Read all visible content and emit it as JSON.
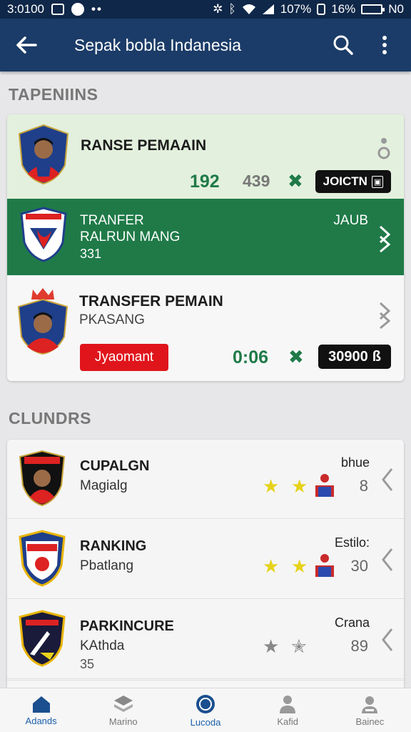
{
  "status_bar": {
    "time": "3:0100",
    "signal_text": "107%",
    "battery": "16%",
    "network": "N0"
  },
  "app_bar": {
    "title": "Sepak bobla Indanesia"
  },
  "sections": {
    "transfers_title": "TAPENIINS",
    "clubs_title": "CLUNDRS"
  },
  "transfers": [
    {
      "title": "RANSE PEMAAIN",
      "value_green": "192",
      "value_gray": "439",
      "pill": "JOICTN"
    },
    {
      "title": "TRANFER",
      "subtitle": "RALRUN MANG",
      "number": "331",
      "right_label": "JAUB"
    },
    {
      "title": "TRANSFER PEMAIN",
      "subtitle": "PKASANG",
      "red_button": "Jyaomant",
      "value_green": "0:06",
      "pill": "30900"
    }
  ],
  "clubs": [
    {
      "name": "CUPALGN",
      "sub": "Magialg",
      "right_label": "bhue",
      "right_val": "8"
    },
    {
      "name": "RANKING",
      "sub": "Pbatlang",
      "right_label": "Estilo:",
      "right_val": "30"
    },
    {
      "name": "PARKINCURE",
      "sub": "KAthda",
      "sub2": "35",
      "right_label": "Crana",
      "right_val": "89"
    }
  ],
  "bottom_nav": [
    "Adands",
    "Marino",
    "Lucoda",
    "Kafid",
    "Bainec"
  ],
  "colors": {
    "primary": "#1b3c68",
    "green": "#1f7a48",
    "red": "#e0151b",
    "light_green": "#e3f0dd"
  }
}
